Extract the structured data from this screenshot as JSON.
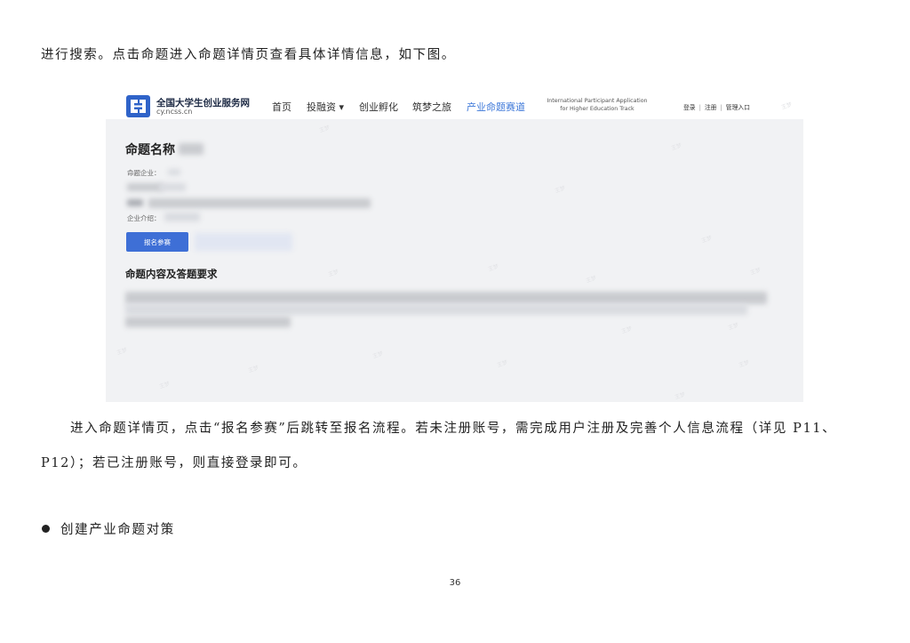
{
  "doc": {
    "line1": "进行搜索。点击命题进入命题详情页查看具体详情信息，如下图。",
    "para_a": "进入命题详情页，点击“报名参赛”后跳转至报名流程。若未注册账号，需完成用户注册及完善个人信息流程（详见 P11、",
    "para_b": "P12）；若已注册账号，则直接登录即可。",
    "bullet": "创建产业命题对策",
    "page_number": "36"
  },
  "screenshot": {
    "site_name": "全国大学生创业服务网",
    "site_url": "cy.ncss.cn",
    "nav": {
      "home": "首页",
      "finance": "投融资 ▾",
      "incubation": "创业孵化",
      "dream_journey": "筑梦之旅",
      "industry_track": "产业命题赛道"
    },
    "nav_note_1": "International Participant Application",
    "nav_note_2": "for Higher Education Track",
    "login": "登录",
    "register": "注册",
    "admin": "管理入口",
    "title": "命题名称",
    "label_company": "命题企业：",
    "label_intro": "企业介绍：",
    "signup_button": "报名参赛",
    "section_heading": "命题内容及答题要求",
    "watermark": "王梦"
  },
  "colors": {
    "accent": "#3e78d9",
    "logo": "#2f63c9",
    "button": "#3e6fd6"
  }
}
